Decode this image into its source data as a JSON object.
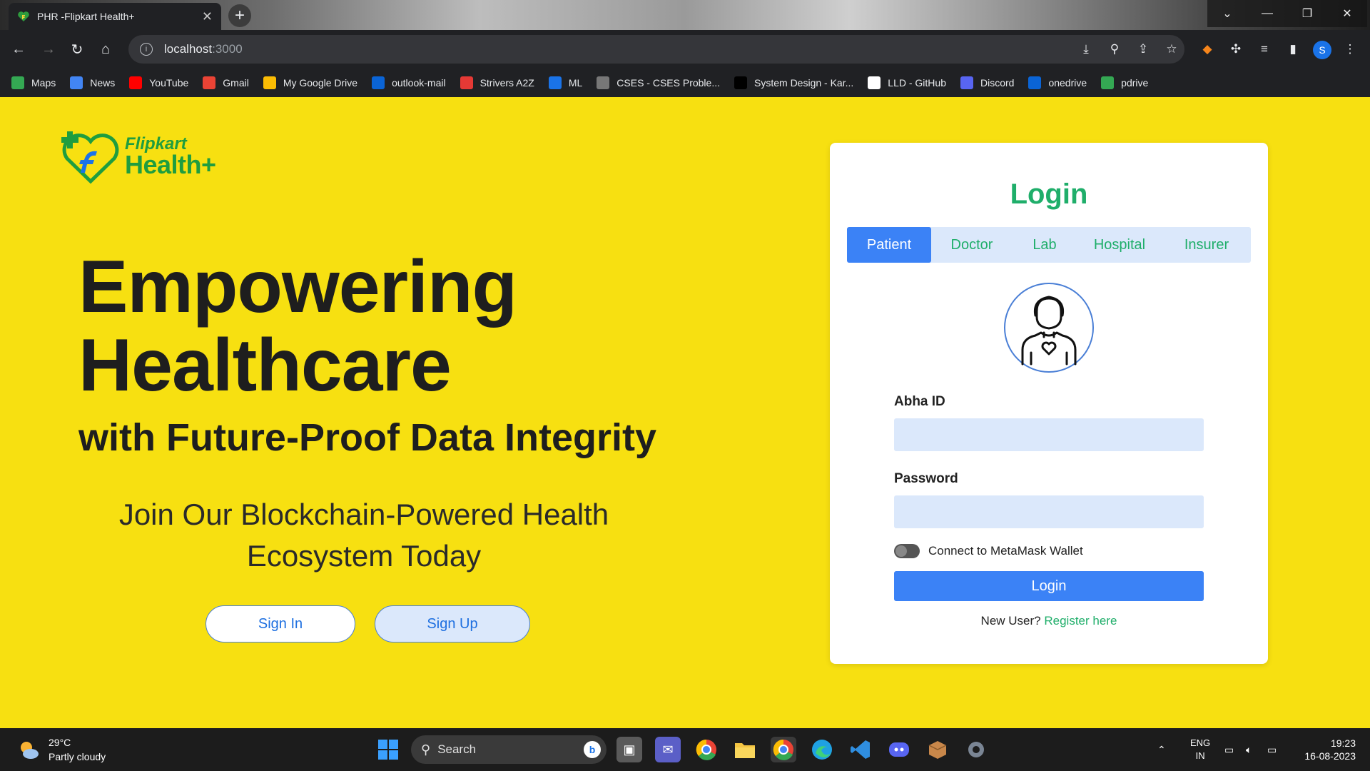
{
  "browser": {
    "tab_title": "PHR -Flipkart Health+",
    "new_tab_symbol": "+",
    "url_host": "localhost",
    "url_port": ":3000",
    "profile_initial": "S",
    "bookmarks": [
      {
        "label": "Maps",
        "color": "#34a853"
      },
      {
        "label": "News",
        "color": "#4285f4"
      },
      {
        "label": "YouTube",
        "color": "#ff0000"
      },
      {
        "label": "Gmail",
        "color": "#ea4335"
      },
      {
        "label": "My Google Drive",
        "color": "#fbbc04"
      },
      {
        "label": "outlook-mail",
        "color": "#0a64d6"
      },
      {
        "label": "Strivers A2Z",
        "color": "#e53935"
      },
      {
        "label": "ML",
        "color": "#1a73e8"
      },
      {
        "label": "CSES - CSES Proble...",
        "color": "#777777"
      },
      {
        "label": "System Design - Kar...",
        "color": "#000000"
      },
      {
        "label": "LLD - GitHub",
        "color": "#ffffff"
      },
      {
        "label": "Discord",
        "color": "#5865f2"
      },
      {
        "label": "onedrive",
        "color": "#0a64d6"
      },
      {
        "label": "pdrive",
        "color": "#34a853"
      }
    ]
  },
  "brand": {
    "line1": "Flipkart",
    "line2": "Health+"
  },
  "hero": {
    "line1": "Empowering",
    "line2": "Healthcare",
    "line3": "with Future-Proof Data Integrity",
    "tagline": "Join Our Blockchain-Powered Health Ecosystem Today"
  },
  "actions": {
    "sign_in": "Sign In",
    "sign_up": "Sign Up"
  },
  "login": {
    "title": "Login",
    "tabs": [
      "Patient",
      "Doctor",
      "Lab",
      "Hospital",
      "Insurer"
    ],
    "active_tab": "Patient",
    "abha_label": "Abha ID",
    "password_label": "Password",
    "metamask_label": "Connect to MetaMask Wallet",
    "metamask_on": false,
    "submit": "Login",
    "new_user_text": "New User?",
    "register_link": "Register here"
  },
  "taskbar": {
    "temperature": "29°C",
    "weather": "Partly cloudy",
    "search_label": "Search",
    "lang": "ENG",
    "region": "IN",
    "time": "19:23",
    "date": "16-08-2023"
  },
  "colors": {
    "page_bg": "#f7e011",
    "accent_green": "#1fae6a",
    "primary_blue": "#3b82f6",
    "input_bg": "#dbe8fb"
  }
}
